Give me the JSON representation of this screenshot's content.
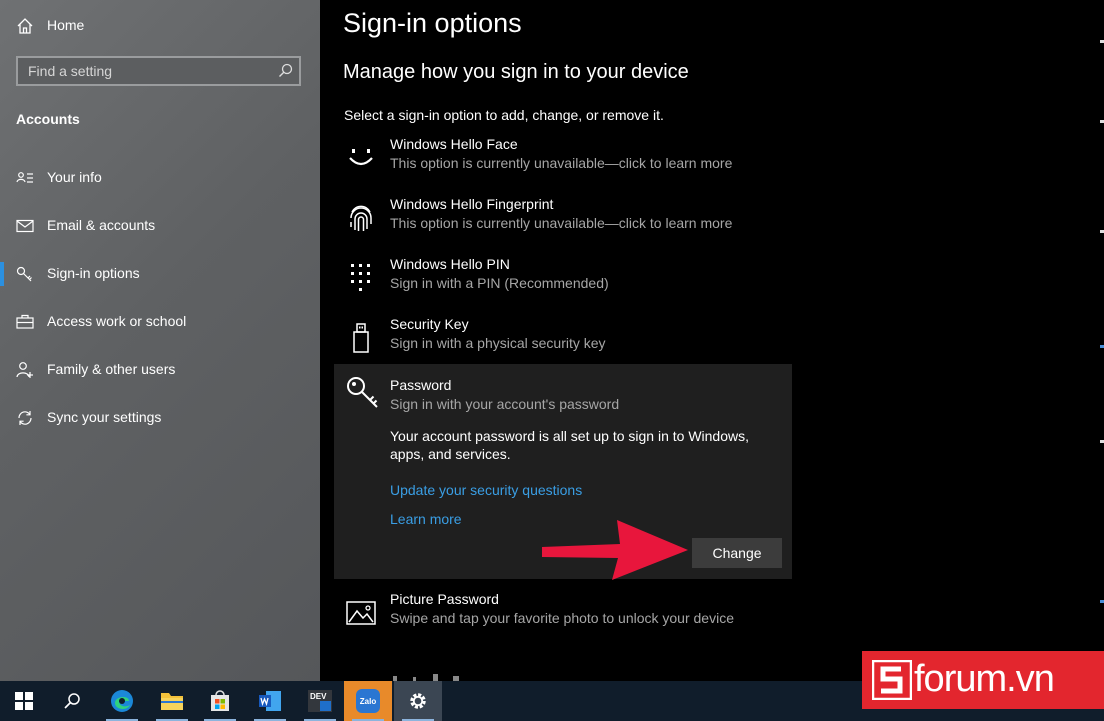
{
  "sidebar": {
    "home_label": "Home",
    "search_placeholder": "Find a setting",
    "section_title": "Accounts",
    "items": [
      {
        "label": "Your info",
        "icon": "person-card-icon"
      },
      {
        "label": "Email & accounts",
        "icon": "mail-icon"
      },
      {
        "label": "Sign-in options",
        "icon": "key-icon",
        "active": true
      },
      {
        "label": "Access work or school",
        "icon": "briefcase-icon"
      },
      {
        "label": "Family & other users",
        "icon": "person-add-icon"
      },
      {
        "label": "Sync your settings",
        "icon": "sync-icon"
      }
    ]
  },
  "main": {
    "title": "Sign-in options",
    "subtitle": "Manage how you sign in to your device",
    "intro": "Select a sign-in option to add, change, or remove it.",
    "options": [
      {
        "title": "Windows Hello Face",
        "desc": "This option is currently unavailable—click to learn more",
        "icon": "face-icon"
      },
      {
        "title": "Windows Hello Fingerprint",
        "desc": "This option is currently unavailable—click to learn more",
        "icon": "fingerprint-icon"
      },
      {
        "title": "Windows Hello PIN",
        "desc": "Sign in with a PIN (Recommended)",
        "icon": "pin-keypad-icon"
      },
      {
        "title": "Security Key",
        "desc": "Sign in with a physical security key",
        "icon": "usb-key-icon"
      }
    ],
    "password": {
      "title": "Password",
      "desc": "Sign in with your account's password",
      "body": "Your account password is all set up to sign in to Windows, apps, and services.",
      "link_security": "Update your security questions",
      "link_learn": "Learn more",
      "change_label": "Change"
    },
    "picture_password": {
      "title": "Picture Password",
      "desc": "Swipe and tap your favorite photo to unlock your device",
      "icon": "picture-icon"
    }
  },
  "taskbar": {
    "zalo_label": "Zalo",
    "dev_label": "DEV"
  },
  "watermark": {
    "brand": "forum.vn"
  },
  "colors": {
    "accent": "#2b90e0",
    "link": "#3a9ee4",
    "arrow": "#e8163c",
    "watermark_bg": "#e3262e"
  }
}
